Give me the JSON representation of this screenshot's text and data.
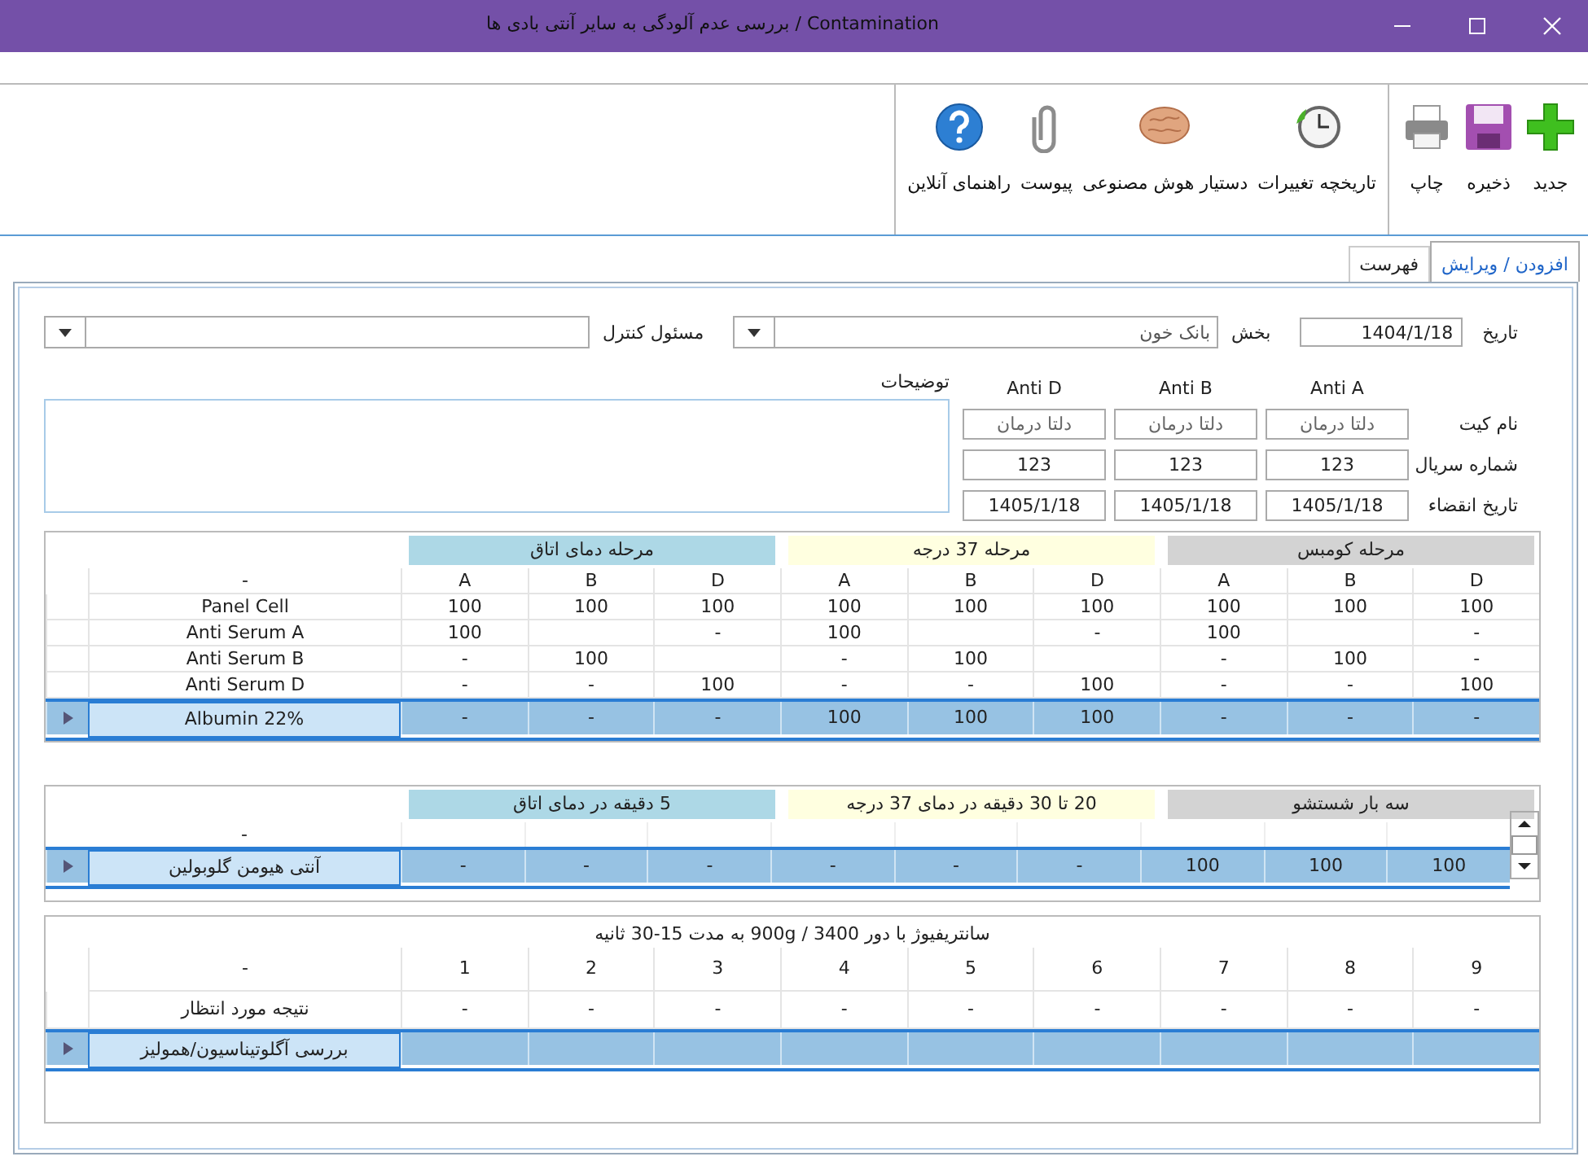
{
  "window": {
    "title": "Contamination / بررسی عدم آلودگی به سایر آنتی بادی ها"
  },
  "toolbar": {
    "groups": [
      [
        "جدید",
        "ذخیره",
        "چاپ"
      ],
      [
        "تاریخچه تغییرات",
        "دستیار هوش مصنوعی",
        "پیوست",
        "راهنمای آنلاین"
      ]
    ]
  },
  "tabs": [
    {
      "label": "افزودن / ویرایش",
      "selected": true
    },
    {
      "label": "فهرست",
      "selected": false
    }
  ],
  "form": {
    "date": {
      "label": "تاریخ",
      "value": "1404/1/18"
    },
    "section": {
      "label": "بخش",
      "value": "بانک خون"
    },
    "controller": {
      "label": "مسئول کنترل"
    },
    "kits": {
      "columns": [
        "Anti A",
        "Anti B",
        "Anti D"
      ],
      "rows": [
        {
          "label": "نام کیت",
          "values": [
            "دلتا درمان",
            "دلتا درمان",
            "دلتا درمان"
          ]
        },
        {
          "label": "شماره سریال",
          "values": [
            "123",
            "123",
            "123"
          ]
        },
        {
          "label": "تاریخ انقضاء",
          "values": [
            "1405/1/18",
            "1405/1/18",
            "1405/1/18"
          ]
        }
      ]
    },
    "notes": {
      "label": "توضیحات"
    }
  },
  "grid_1": {
    "groups": [
      {
        "label": "مرحله کومبس",
        "color": "#d3d3d3"
      },
      {
        "label": "مرحله 37 درجه",
        "color": "#ffffe0"
      },
      {
        "label": "مرحله دمای اتاق",
        "color": "#add8e6"
      }
    ],
    "columns": [
      "D",
      "B",
      "A",
      "D",
      "B",
      "A",
      "D",
      "B",
      "A"
    ],
    "name_header": "-",
    "rows": [
      {
        "cells": [
          "100",
          "100",
          "100",
          "100",
          "100",
          "100",
          "100",
          "100",
          "100"
        ],
        "name": "Panel Cell",
        "selected": false
      },
      {
        "cells": [
          "-",
          "",
          "100",
          "-",
          "",
          "100",
          "-",
          "",
          "100"
        ],
        "name": "Anti Serum A",
        "selected": false
      },
      {
        "cells": [
          "-",
          "100",
          "-",
          "",
          "100",
          "-",
          "",
          "100",
          "-"
        ],
        "name": "Anti Serum B",
        "selected": false
      },
      {
        "cells": [
          "100",
          "-",
          "-",
          "100",
          "-",
          "-",
          "100",
          "-",
          "-"
        ],
        "name": "Anti Serum D",
        "selected": false
      },
      {
        "cells": [
          "-",
          "-",
          "-",
          "100",
          "100",
          "100",
          "-",
          "-",
          "-"
        ],
        "name": "Albumin 22%",
        "selected": true
      }
    ]
  },
  "grid_2": {
    "groups": [
      {
        "label": "سه بار شستشو",
        "color": "#d3d3d3"
      },
      {
        "label": "20 تا 30 دقیقه در دمای 37 درجه",
        "color": "#ffffe0"
      },
      {
        "label": "5 دقیقه در دمای اتاق",
        "color": "#add8e6"
      }
    ],
    "name_header": "-",
    "rows": [
      {
        "cells": [
          "100",
          "100",
          "100",
          "-",
          "-",
          "-",
          "-",
          "-",
          "-"
        ],
        "name": "آنتی هیومن گلوبولین",
        "selected": true
      }
    ]
  },
  "grid_3": {
    "caption": "سانتریفیوژ با دور 3400 / 900g به مدت 15-30 ثانیه",
    "columns": [
      "9",
      "8",
      "7",
      "6",
      "5",
      "4",
      "3",
      "2",
      "1"
    ],
    "name_header": "-",
    "rows": [
      {
        "cells": [
          "-",
          "-",
          "-",
          "-",
          "-",
          "-",
          "-",
          "-",
          "-"
        ],
        "name": "نتیجه مورد انتظار",
        "selected": false
      },
      {
        "cells": [
          "",
          "",
          "",
          "",
          "",
          "",
          "",
          "",
          ""
        ],
        "name": "بررسی آگلوتیناسیون/همولیز",
        "selected": true
      }
    ]
  }
}
